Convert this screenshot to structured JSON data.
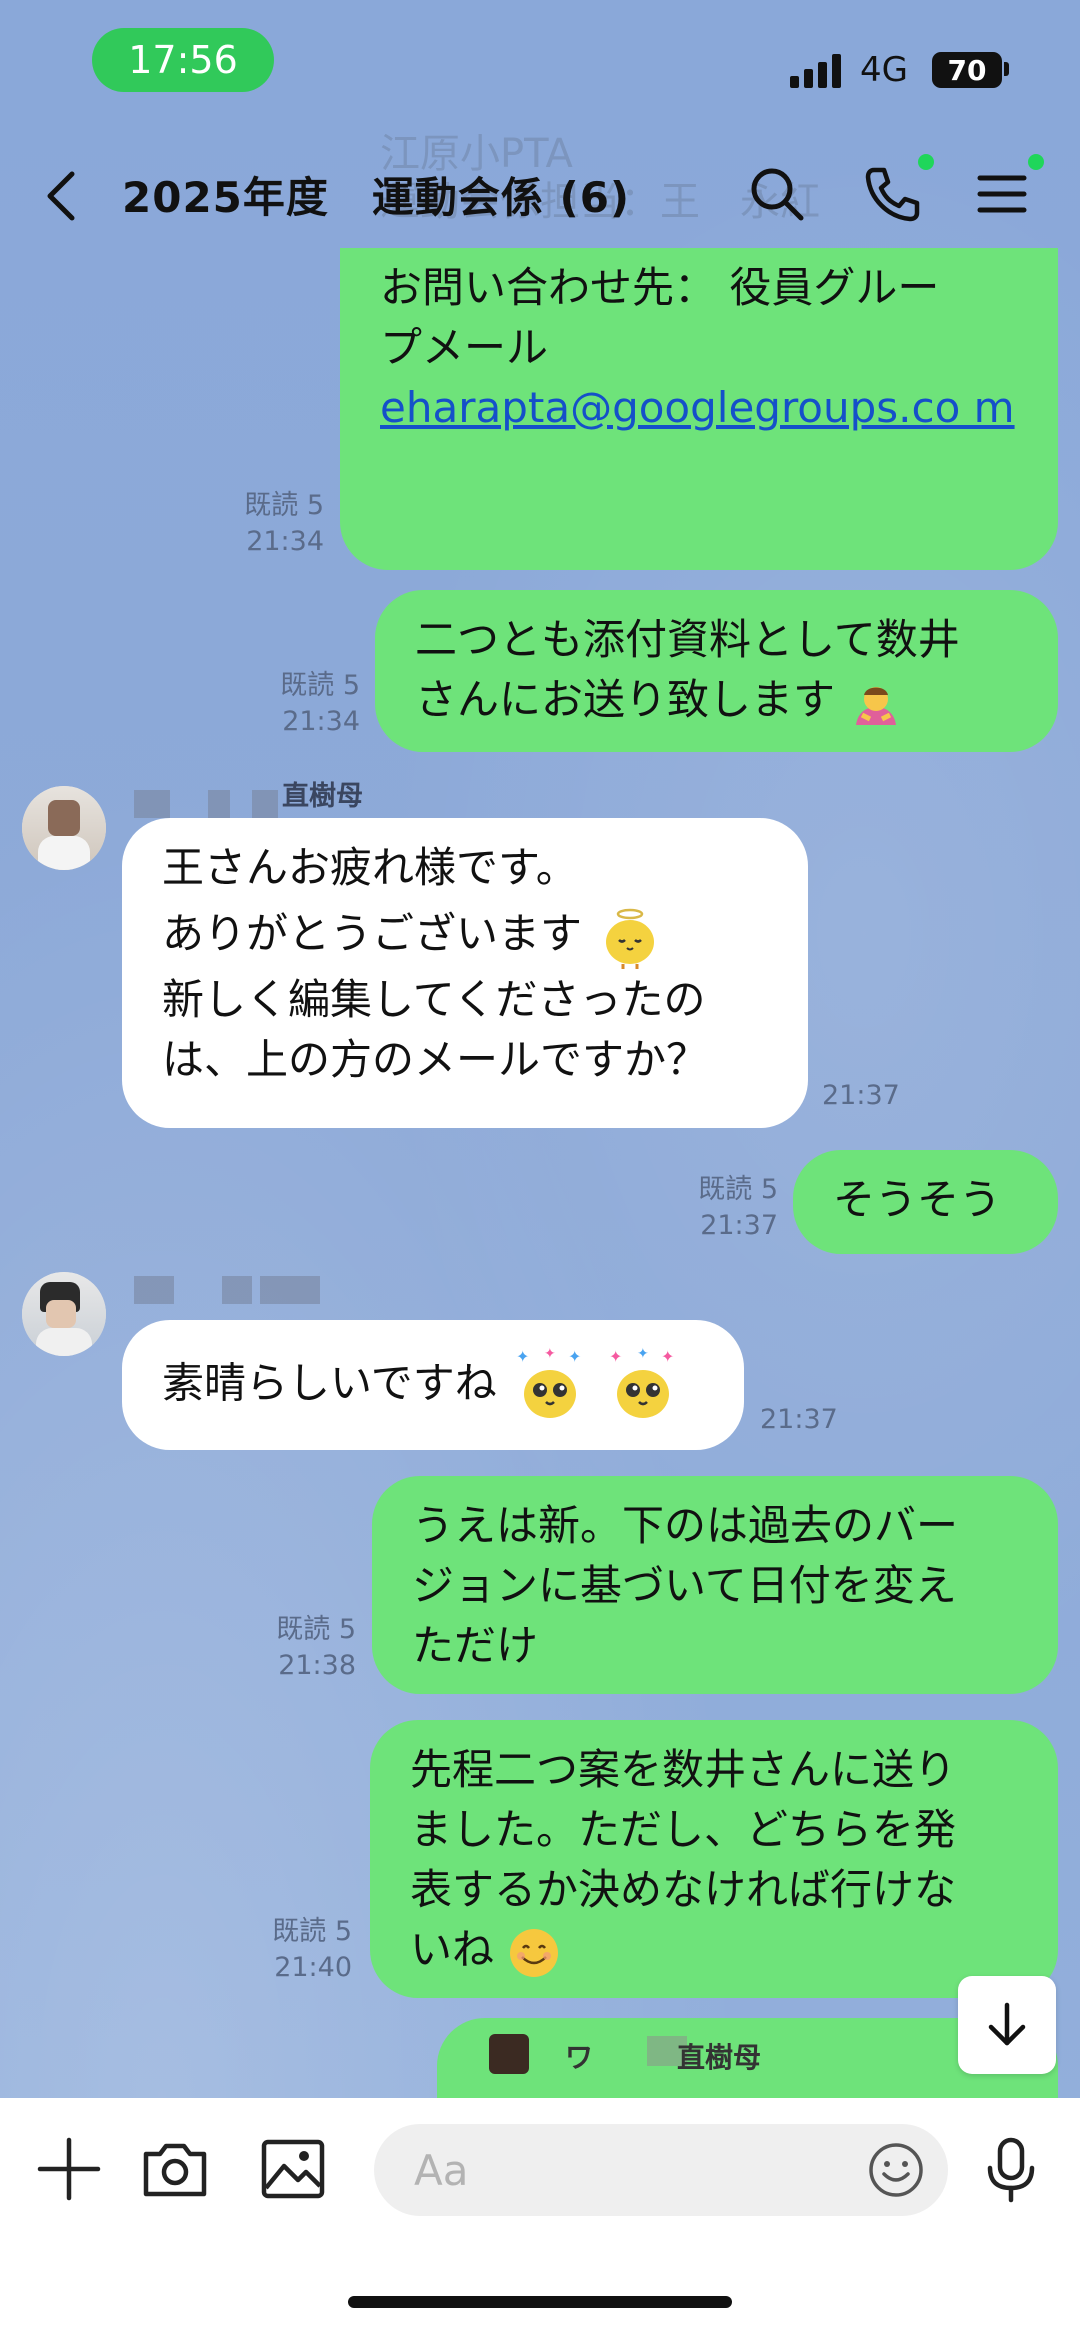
{
  "status_bar": {
    "time": "17:56",
    "network": "4G",
    "battery": "70"
  },
  "header": {
    "title": "2025年度　運動会係 (6)",
    "ghost_lines": [
      "江原小PTA",
      "運動会係担当：王　永紅"
    ]
  },
  "messages": [
    {
      "dir": "out",
      "lines": [
        "お問い合わせ先： 役員グルー",
        "プメール"
      ],
      "link": "eharapta@googlegroups.co m",
      "read": "既読 5",
      "time": "21:34"
    },
    {
      "dir": "out",
      "lines": [
        "二つとも添付資料として数井",
        "さんにお送り致します"
      ],
      "emoji": "bow",
      "read": "既読 5",
      "time": "21:34"
    },
    {
      "dir": "in",
      "sender": "直樹母",
      "lines": [
        "王さんお疲れ様です。",
        "ありがとうございます",
        "新しく編集してくださったの",
        "は、上の方のメールですか？"
      ],
      "time": "21:37"
    },
    {
      "dir": "out",
      "lines": [
        "そうそう"
      ],
      "read": "既読 5",
      "time": "21:37"
    },
    {
      "dir": "in",
      "lines": [
        "素晴らしいですね"
      ],
      "time": "21:37"
    },
    {
      "dir": "out",
      "lines": [
        "うえは新。下のは過去のバー",
        "ジョンに基づいて日付を変え",
        "ただけ"
      ],
      "read": "既読 5",
      "time": "21:38"
    },
    {
      "dir": "out",
      "lines": [
        "先程二つ案を数井さんに送り",
        "ました。ただし、どちらを発",
        "表するか決めなければ行けな",
        "いね"
      ],
      "read": "既読 5",
      "time": "21:40"
    },
    {
      "dir": "out",
      "reply_preview": "ワ　　　直樹母"
    }
  ],
  "composer": {
    "placeholder": "Aa"
  },
  "colors": {
    "outgoing": "#6ee37a",
    "incoming": "#ffffff",
    "background": "#8ba9d8",
    "time_pill": "#31c95a"
  }
}
